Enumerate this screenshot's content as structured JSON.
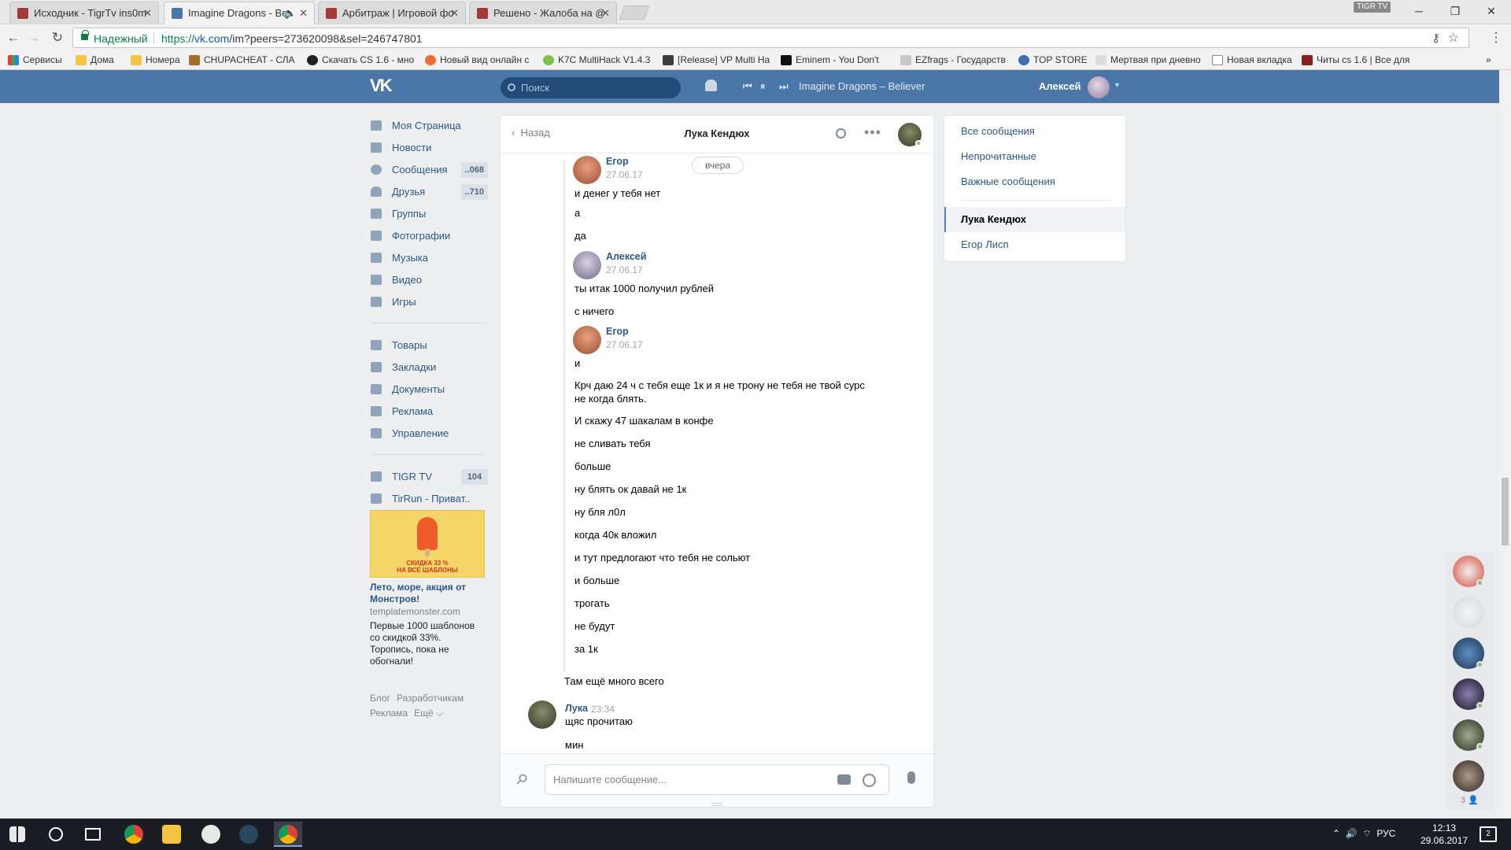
{
  "browser": {
    "tabs": [
      {
        "title": "Исходник - TigrTv ins0m",
        "fav_color": "#a13b3b"
      },
      {
        "title": "Imagine Dragons - Be",
        "fav_color": "#4a76a8"
      },
      {
        "title": "Арбитраж | Игровой фо",
        "fav_color": "#a13b3b"
      },
      {
        "title": "Решено - Жалоба на @",
        "fav_color": "#a13b3b"
      }
    ],
    "profile_badge": "TIGR TV",
    "secure_label": "Надежный",
    "url_scheme": "https://",
    "url_host": "vk.com",
    "url_path": "/im?peers=273620098&sel=246747801",
    "bookmarks": [
      {
        "label": "Сервисы",
        "color": "#e53935"
      },
      {
        "label": "Дома",
        "color": "#f5c542"
      },
      {
        "label": "Номера",
        "color": "#f5c542"
      },
      {
        "label": "CHUPACHEAT - СЛА",
        "color": "#a07028"
      },
      {
        "label": "Скачать CS 1.6 - мно",
        "color": "#222222"
      },
      {
        "label": "Новый вид онлайн с",
        "color": "#ef6c2f"
      },
      {
        "label": "K7C MultiHack V1.4.3",
        "color": "#7cc142"
      },
      {
        "label": "[Release] VP Multi Ha",
        "color": "#3c3c3c"
      },
      {
        "label": "Eminem - You Don't",
        "color": "#111111"
      },
      {
        "label": "EZfrags - Государств",
        "color": "#c8c8c8"
      },
      {
        "label": "TOP STORE",
        "color": "#3d6fb5"
      },
      {
        "label": "Мертвая при дневно",
        "color": "#dddddd"
      },
      {
        "label": "Новая вкладка",
        "color": "#ffffff"
      },
      {
        "label": "Читы cs 1.6 | Все для",
        "color": "#8a1f1f"
      }
    ]
  },
  "vk": {
    "logo": "VK",
    "search_placeholder": "Поиск",
    "player_track": "Imagine Dragons – Believer",
    "user_name": "Алексей",
    "nav": [
      {
        "label": "Моя Страница",
        "icon": "home-icon",
        "count": ""
      },
      {
        "label": "Новости",
        "icon": "news-icon",
        "count": ""
      },
      {
        "label": "Сообщения",
        "icon": "messages-icon",
        "count": "..068"
      },
      {
        "label": "Друзья",
        "icon": "friends-icon",
        "count": "..710"
      },
      {
        "label": "Группы",
        "icon": "groups-icon",
        "count": ""
      },
      {
        "label": "Фотографии",
        "icon": "camera-icon",
        "count": ""
      },
      {
        "label": "Музыка",
        "icon": "music-icon",
        "count": ""
      },
      {
        "label": "Видео",
        "icon": "video-icon",
        "count": ""
      },
      {
        "label": "Игры",
        "icon": "gamepad-icon",
        "count": ""
      }
    ],
    "nav2": [
      {
        "label": "Товары",
        "icon": "bag-icon",
        "count": ""
      },
      {
        "label": "Закладки",
        "icon": "star-icon",
        "count": ""
      },
      {
        "label": "Документы",
        "icon": "document-icon",
        "count": ""
      },
      {
        "label": "Реклама",
        "icon": "ads-icon",
        "count": ""
      },
      {
        "label": "Управление",
        "icon": "gamepad-icon",
        "count": ""
      }
    ],
    "nav3": [
      {
        "label": "TIGR TV",
        "icon": "community-icon",
        "count": "104"
      },
      {
        "label": "TirRun - Приват..",
        "icon": "community-icon",
        "count": ""
      }
    ],
    "ad": {
      "banner_line1": "СКИДКА 33 %",
      "banner_line2": "НА ВСЕ ШАБЛОНЫ",
      "title": "Лето, море, акция от Монстров!",
      "domain": "templatemonster.com",
      "body": "Первые 1000 шаблонов со скидкой 33%. Торопись, пока не обогнали!"
    },
    "footer": [
      "Блог",
      "Разработчикам",
      "Реклама",
      "Ещё ⌵"
    ]
  },
  "chat": {
    "back_label": "Назад",
    "title": "Лука Кендюх",
    "date_pill": "вчера",
    "headers": [
      {
        "name": "Егор",
        "date": "27.06.17"
      },
      {
        "name": "Алексей",
        "date": "27.06.17"
      },
      {
        "name": "Егор",
        "date": "27.06.17"
      },
      {
        "name": "Лука",
        "date": "23:34"
      }
    ],
    "messages": [
      "и денег у тебя нет",
      "а",
      "да",
      "ты итак 1000 получил рублей",
      "с ничего",
      "и",
      "Крч даю 24 ч с тебя еще 1к и я не трону не тебя не твой сурс",
      "не когда блять.",
      "И скажу 47 шакалам в конфе",
      "не сливать тебя",
      "больше",
      "ну блять ок давай не 1к",
      "ну бля л0л",
      "когда 40к вложил",
      "и тут предлогают что тебя не сольют",
      "и больше",
      "трогать",
      "не будут",
      "за 1к",
      "Там ещё много всего",
      "щяс прочитаю",
      "мин"
    ],
    "composer_placeholder": "Напишите сообщение..."
  },
  "right_panel": {
    "items": [
      "Все сообщения",
      "Непрочитанные",
      "Важные сообщения"
    ],
    "dialogs": [
      "Лука Кендюх",
      "Егор Лисп"
    ]
  },
  "online_count": "3 👤",
  "taskbar": {
    "lang": "РУС",
    "time": "12:13",
    "date": "29.06.2017",
    "notif_count": "2"
  }
}
